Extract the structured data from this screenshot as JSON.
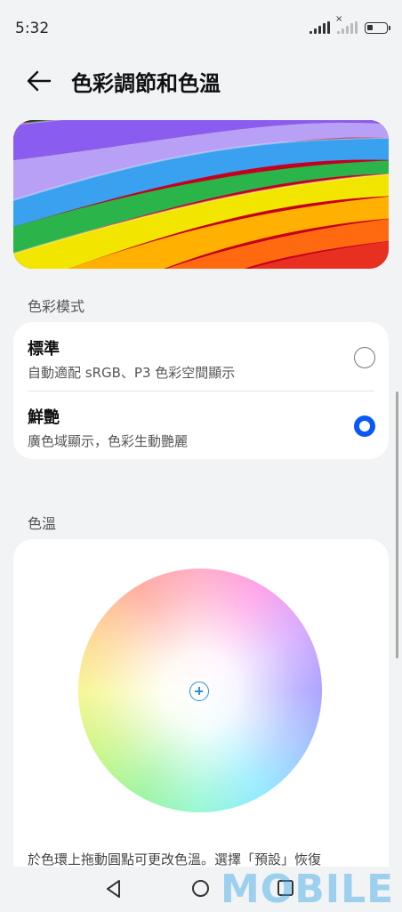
{
  "status_bar": {
    "time": "5:32"
  },
  "header": {
    "title": "色彩調節和色溫",
    "back_icon": "arrow-left-icon"
  },
  "color_mode": {
    "label": "色彩模式",
    "options": [
      {
        "title": "標準",
        "description": "自動適配 sRGB、P3 色彩空間顯示",
        "selected": false
      },
      {
        "title": "鮮艷",
        "description": "廣色域顯示，色彩生動艷麗",
        "selected": true
      }
    ]
  },
  "color_temperature": {
    "label": "色溫",
    "hint": "於色環上拖動圓點可更改色溫。選擇「預設」恢復"
  },
  "watermark": "MOBILE",
  "colors": {
    "accent": "#0a59f7",
    "background": "#f1f3f5",
    "card": "#ffffff"
  }
}
